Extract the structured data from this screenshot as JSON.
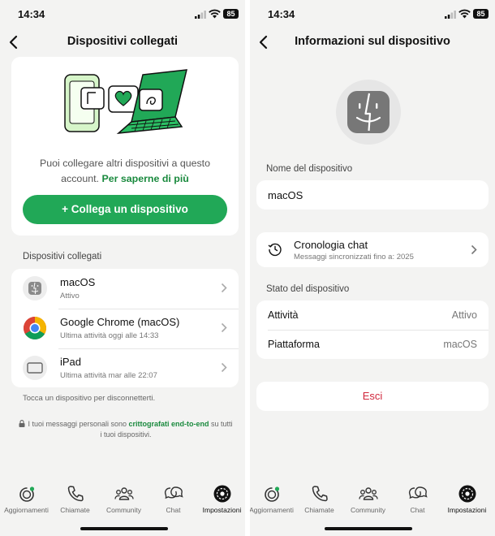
{
  "status_bar": {
    "time": "14:34",
    "battery": "85"
  },
  "left": {
    "title": "Dispositivi collegati",
    "hero": {
      "description": "Puoi collegare altri dispositivi a questo account.",
      "learn_more": "Per saperne di più",
      "button_label": "+ Collega un dispositivo"
    },
    "section_label": "Dispositivi collegati",
    "devices": [
      {
        "name": "macOS",
        "subtitle": "Attivo",
        "icon": "finder-icon"
      },
      {
        "name": "Google Chrome (macOS)",
        "subtitle": "Ultima attività oggi alle 14:33",
        "icon": "chrome-icon"
      },
      {
        "name": "iPad",
        "subtitle": "Ultima attività mar alle 22:07",
        "icon": "tablet-icon"
      }
    ],
    "hint": "Tocca un dispositivo per disconnetterti.",
    "e2e": {
      "before": "I tuoi messaggi personali sono ",
      "link": "crittografati end-to-end",
      "after": " su tutti i tuoi dispositivi."
    }
  },
  "right": {
    "title": "Informazioni sul dispositivo",
    "name_label": "Nome del dispositivo",
    "name_value": "macOS",
    "history": {
      "title": "Cronologia chat",
      "subtitle": "Messaggi sincronizzati fino a: 2025"
    },
    "state_label": "Stato del dispositivo",
    "activity": {
      "label": "Attività",
      "value": "Attivo"
    },
    "platform": {
      "label": "Piattaforma",
      "value": "macOS"
    },
    "logout_label": "Esci"
  },
  "tabs": [
    {
      "label": "Aggiornamenti",
      "icon": "updates-icon"
    },
    {
      "label": "Chiamate",
      "icon": "phone-icon"
    },
    {
      "label": "Community",
      "icon": "community-icon"
    },
    {
      "label": "Chat",
      "icon": "chat-icon"
    },
    {
      "label": "Impostazioni",
      "icon": "settings-icon",
      "active": true
    }
  ],
  "colors": {
    "accent": "#21a857",
    "link": "#1a8a3e",
    "destructive": "#d0273c",
    "background": "#f3f3f2"
  }
}
